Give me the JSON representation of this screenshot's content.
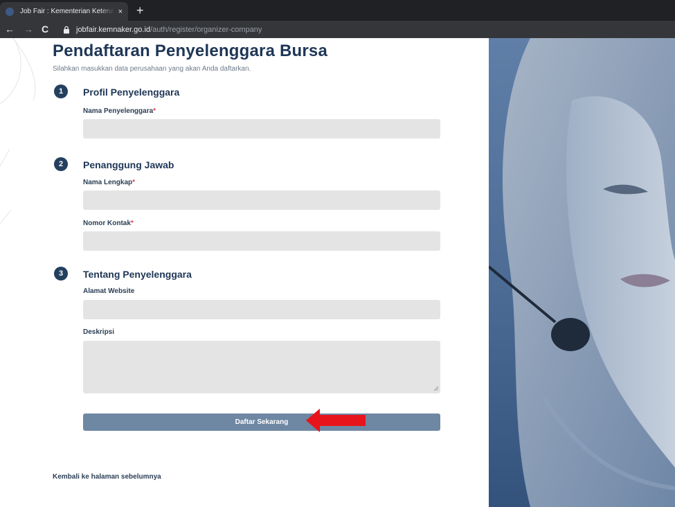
{
  "browser": {
    "tab_title": "Job Fair : Kementerian Ketenagakerjaan",
    "tab_close": "×",
    "new_tab": "+",
    "nav_back": "←",
    "nav_forward": "→",
    "nav_reload": "C",
    "url_host": "jobfair.kemnaker.go.id",
    "url_path": "/auth/register/organizer-company"
  },
  "page": {
    "title": "Pendaftaran Penyelenggara Bursa",
    "subtitle": "Silahkan masukkan data perusahaan yang akan Anda daftarkan."
  },
  "sections": [
    {
      "number": "1",
      "title": "Profil Penyelenggara",
      "fields": [
        {
          "label": "Nama Penyelenggara",
          "required_mark": "*",
          "value": ""
        }
      ]
    },
    {
      "number": "2",
      "title": "Penanggung Jawab",
      "fields": [
        {
          "label": "Nama Lengkap",
          "required_mark": "*",
          "value": ""
        },
        {
          "label": "Nomor Kontak",
          "required_mark": "*",
          "value": ""
        }
      ]
    },
    {
      "number": "3",
      "title": "Tentang Penyelenggara",
      "fields": [
        {
          "label": "Alamat Website",
          "value": ""
        },
        {
          "label": "Deskripsi",
          "value": ""
        }
      ]
    }
  ],
  "submit": {
    "label": "Daftar Sekarang"
  },
  "back_link": {
    "label": "Kembali ke halaman sebelumnya"
  },
  "colors": {
    "brand_navy": "#1e3656",
    "button": "#6e87a3",
    "input_bg": "#e4e4e4",
    "required": "#e23b4b",
    "annotation_arrow": "#e8141b"
  },
  "icons": {
    "lock": "lock-icon",
    "annotation": "red-arrow-icon"
  }
}
